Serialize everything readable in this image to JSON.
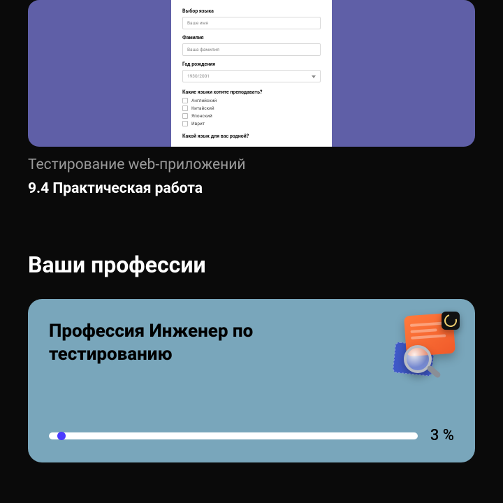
{
  "course": {
    "subtitle": "Тестирование web-приложений",
    "title": "9.4 Практическая работа",
    "form": {
      "lang_label": "Выбор языка",
      "lang_placeholder": "Ваше имя",
      "surname_label": "Фамилия",
      "surname_placeholder": "Ваша фамилия",
      "year_label": "Год рождения",
      "year_value": "1930/2001",
      "question1": "Какие языки хотите преподавать?",
      "options": [
        "Английский",
        "Китайский",
        "Японский",
        "Иврит"
      ],
      "question2": "Какой язык для вас родной?"
    }
  },
  "professions": {
    "heading": "Ваши профессии",
    "cards": [
      {
        "title": "Профессия Инженер по тестированию",
        "progress_percent": 3,
        "progress_label": "3 %"
      }
    ]
  },
  "colors": {
    "accent_purple": "#5f5fa7",
    "card_blue": "#79a6bb",
    "progress_dot": "#4b3bff",
    "icon_orange": "#ff6a33"
  }
}
